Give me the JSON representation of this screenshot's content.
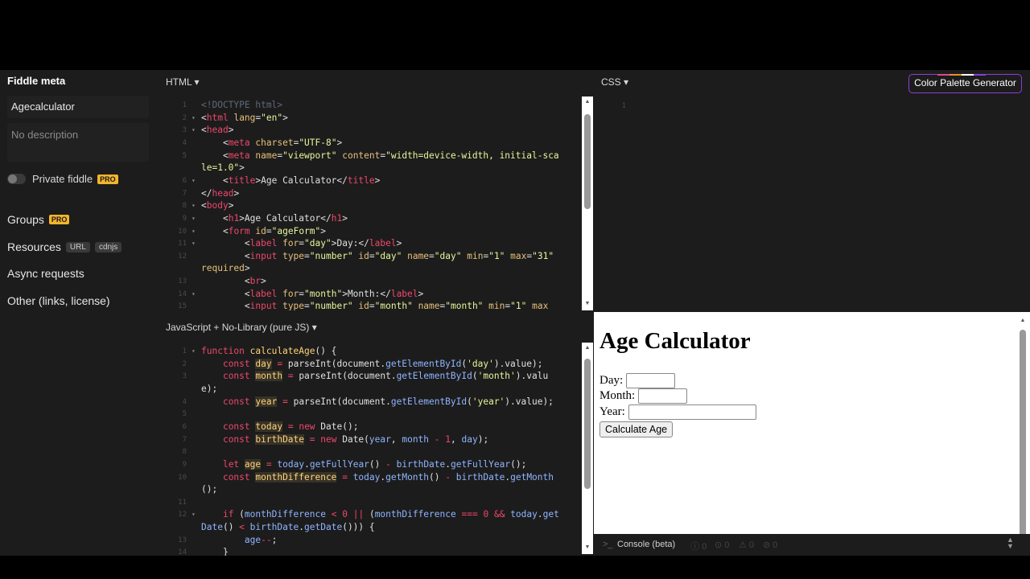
{
  "sidebar": {
    "title": "Fiddle meta",
    "fiddle_name": "Agecalculator",
    "description_placeholder": "No description",
    "private_label": "Private fiddle",
    "pro_badge": "PRO",
    "groups_label": "Groups",
    "resources_label": "Resources",
    "url_tag": "URL",
    "cdnjs_tag": "cdnjs",
    "async_label": "Async requests",
    "other_label": "Other (links, license)"
  },
  "html_panel": {
    "label": "HTML ▾",
    "lines": [
      {
        "n": "1",
        "fold": ""
      },
      {
        "n": "2",
        "fold": "▾"
      },
      {
        "n": "3",
        "fold": "▾"
      },
      {
        "n": "4",
        "fold": ""
      },
      {
        "n": "5",
        "fold": ""
      },
      {
        "n": "",
        "fold": ""
      },
      {
        "n": "6",
        "fold": "▾"
      },
      {
        "n": "7",
        "fold": ""
      },
      {
        "n": "8",
        "fold": "▾"
      },
      {
        "n": "9",
        "fold": "▾"
      },
      {
        "n": "10",
        "fold": "▾"
      },
      {
        "n": "11",
        "fold": "▾"
      },
      {
        "n": "12",
        "fold": ""
      },
      {
        "n": "",
        "fold": ""
      },
      {
        "n": "13",
        "fold": ""
      },
      {
        "n": "14",
        "fold": "▾"
      },
      {
        "n": "15",
        "fold": ""
      }
    ]
  },
  "css_panel": {
    "label": "CSS ▾",
    "line1": "1"
  },
  "js_panel": {
    "label": "JavaScript + No-Library (pure JS) ▾",
    "lines": [
      {
        "n": "1",
        "fold": "▾"
      },
      {
        "n": "2",
        "fold": ""
      },
      {
        "n": "3",
        "fold": ""
      },
      {
        "n": "",
        "fold": ""
      },
      {
        "n": "4",
        "fold": ""
      },
      {
        "n": "5",
        "fold": ""
      },
      {
        "n": "6",
        "fold": ""
      },
      {
        "n": "7",
        "fold": ""
      },
      {
        "n": "8",
        "fold": ""
      },
      {
        "n": "9",
        "fold": ""
      },
      {
        "n": "10",
        "fold": ""
      },
      {
        "n": "",
        "fold": ""
      },
      {
        "n": "11",
        "fold": ""
      },
      {
        "n": "12",
        "fold": "▾"
      },
      {
        "n": "",
        "fold": ""
      },
      {
        "n": "13",
        "fold": ""
      },
      {
        "n": "14",
        "fold": ""
      }
    ]
  },
  "palette_button": "Color Palette Generator",
  "palette_colors": [
    "#e0488b",
    "#f08c2a",
    "#ffffff",
    "#8b3fd9"
  ],
  "result": {
    "heading": "Age Calculator",
    "day_label": "Day:",
    "month_label": "Month:",
    "year_label": "Year:",
    "button": "Calculate Age"
  },
  "console": {
    "label": "Console (beta)",
    "count_info": "0",
    "count_log": "0",
    "count_warn": "0",
    "count_error": "0"
  }
}
